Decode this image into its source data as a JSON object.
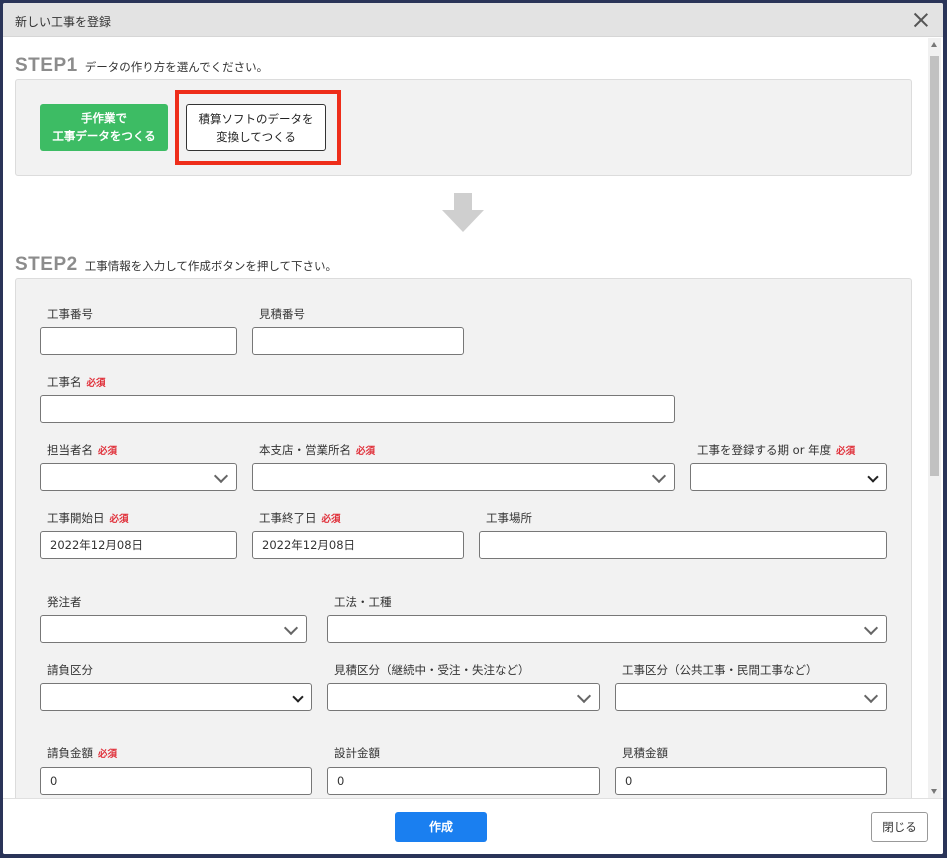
{
  "modal": {
    "title": "新しい工事を登録"
  },
  "step1": {
    "num": "STEP1",
    "desc": "データの作り方を選んでください。",
    "manual_btn": [
      "手作業で",
      "工事データをつくる"
    ],
    "convert_btn": [
      "積算ソフトのデータを",
      "変換してつくる"
    ]
  },
  "step2": {
    "num": "STEP2",
    "desc": "工事情報を入力して作成ボタンを押して下さい。"
  },
  "required_badge": "必須",
  "fields": {
    "koji_bango": {
      "label": "工事番号",
      "value": ""
    },
    "mitsumori_bango": {
      "label": "見積番号",
      "value": ""
    },
    "koji_mei": {
      "label": "工事名",
      "value": ""
    },
    "tantosha": {
      "label": "担当者名",
      "value": ""
    },
    "honshiten": {
      "label": "本支店・営業所名",
      "value": ""
    },
    "period": {
      "label": "工事を登録する期 or 年度",
      "value": ""
    },
    "start_date": {
      "label": "工事開始日",
      "value": "2022年12月08日"
    },
    "end_date": {
      "label": "工事終了日",
      "value": "2022年12月08日"
    },
    "basho": {
      "label": "工事場所",
      "value": ""
    },
    "hacchusha": {
      "label": "発注者",
      "value": ""
    },
    "koho": {
      "label": "工法・工種",
      "value": ""
    },
    "ukeoi_kubun": {
      "label": "請負区分",
      "value": ""
    },
    "mitsumori_kubun": {
      "label": "見積区分（継続中・受注・失注など）",
      "value": ""
    },
    "koji_kubun": {
      "label": "工事区分（公共工事・民間工事など）",
      "value": ""
    },
    "ukeoi_kingaku": {
      "label": "請負金額",
      "value": "0"
    },
    "sekkei_kingaku": {
      "label": "設計金額",
      "value": "0"
    },
    "mitsumori_kingaku": {
      "label": "見積金額",
      "value": "0"
    }
  },
  "footer": {
    "create": "作成",
    "close": "閉じる"
  }
}
